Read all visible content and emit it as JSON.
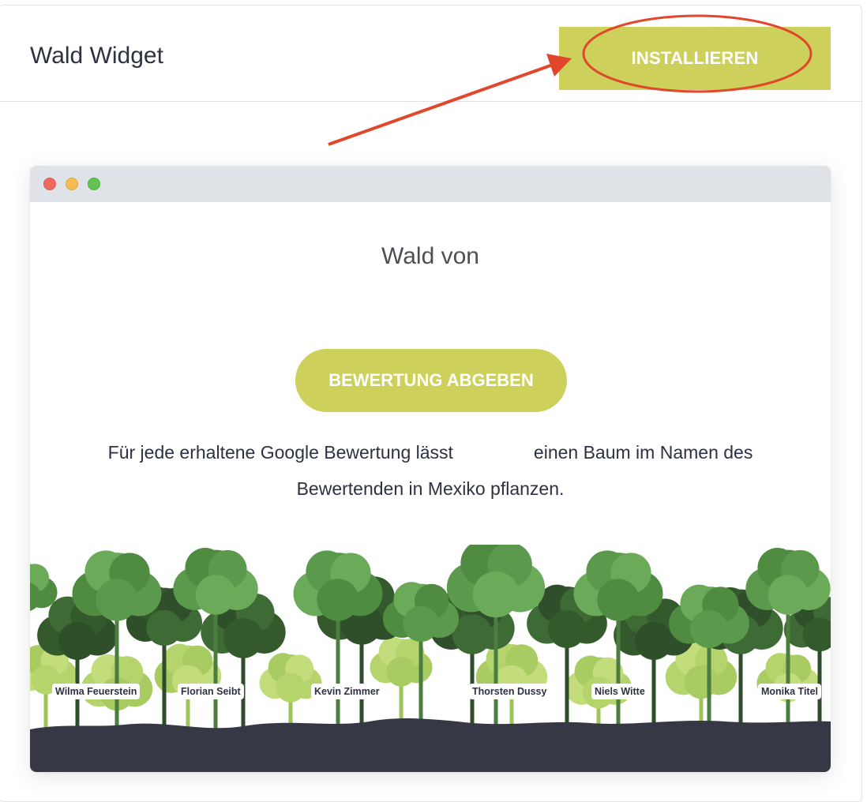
{
  "header": {
    "title": "Wald Widget",
    "install_label": "INSTALLIEREN"
  },
  "preview": {
    "heading": "Wald von",
    "review_button": "BEWERTUNG ABGEBEN",
    "description_part1": "Für jede erhaltene Google Bewertung lässt",
    "description_part2": "einen Baum im Namen des",
    "description_line2": "Bewertenden in Mexiko pflanzen.",
    "reviewers": [
      "Wilma Feuerstein",
      "Florian Seibt",
      "Kevin Zimmer",
      "Thorsten Dussy",
      "Niels Witte",
      "Monika Titel"
    ]
  },
  "colors": {
    "accent": "#cdd15b",
    "annotation": "#e0472b",
    "ground": "#363845",
    "tree_dark": "#3e6b35",
    "tree_mid": "#5b9a4c",
    "tree_light": "#a8cc62"
  }
}
